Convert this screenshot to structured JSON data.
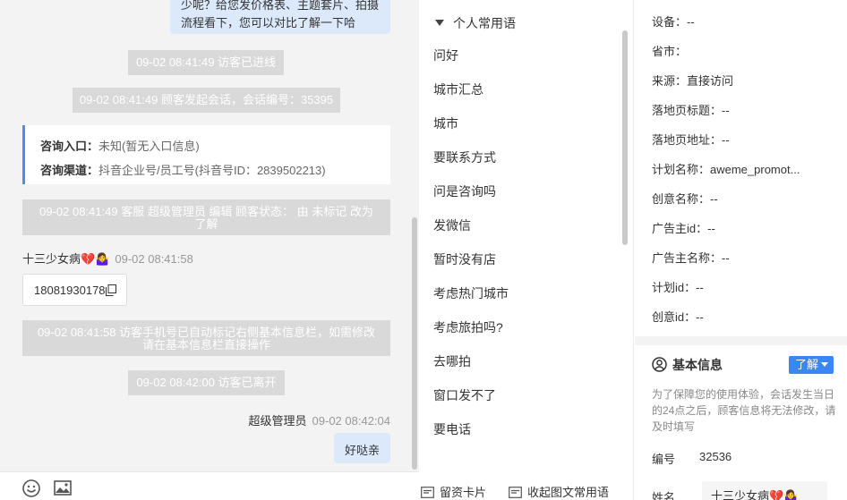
{
  "chat": {
    "agent_bubble_text": "少呢？给您发价格表、主题套片、拍摄流程看下，您可以对比了解一下哈",
    "system_messages": [
      "09-02 08:41:49 访客已进线",
      "09-02 08:41:49 顾客发起会话，会话编号：35395",
      "09-02 08:41:49 客服 超级管理员 编辑 顾客状态： 由 未标记 改为 了解",
      "09-02 08:41:58 访客手机号已自动标记右侧基本信息栏，如需修改请在基本信息栏直接操作",
      "09-02 08:42:00 访客已离开"
    ],
    "entry": {
      "entrance_label": "咨询入口：",
      "entrance_value": "未知(暂无入口信息)",
      "channel_label": "咨询渠道：",
      "channel_value": "抖音企业号/员工号(抖音号ID：2839502213)"
    },
    "visitor_name": "十三少女病💔🤷‍♀️",
    "visitor_time": "09-02 08:41:58",
    "visitor_phone": "18081930178",
    "agent_name": "超级管理员",
    "agent_time": "09-02 08:42:04",
    "agent_reply": "好哒亲"
  },
  "phrases": {
    "header": "个人常用语",
    "items": [
      "问好",
      "城市汇总",
      "城市",
      "要联系方式",
      "问是咨询吗",
      "发微信",
      "暂时没有店",
      "考虑热门城市",
      "考虑旅拍吗?",
      "去哪拍",
      "窗口发不了",
      "要电话"
    ],
    "footer_left": "留资卡片",
    "footer_right": "收起图文常用语"
  },
  "info": {
    "rows": [
      "设备：--",
      "省市：",
      "来源：直接访问",
      "落地页标题：--",
      "落地页地址：--",
      "计划名称：aweme_promot...",
      "创意名称：--",
      "广告主id：--",
      "广告主名称：--",
      "计划id：--",
      "创意id：--"
    ],
    "basic_title": "基本信息",
    "know_button": "了解",
    "notice": "为了保障您的使用体验，会话发生当日的24点之后，顾客信息将无法修改，请及时填写",
    "id_label": "编号",
    "id_value": "32536",
    "name_label": "姓名",
    "name_value": "十三少女病💔🤷‍♀️"
  }
}
